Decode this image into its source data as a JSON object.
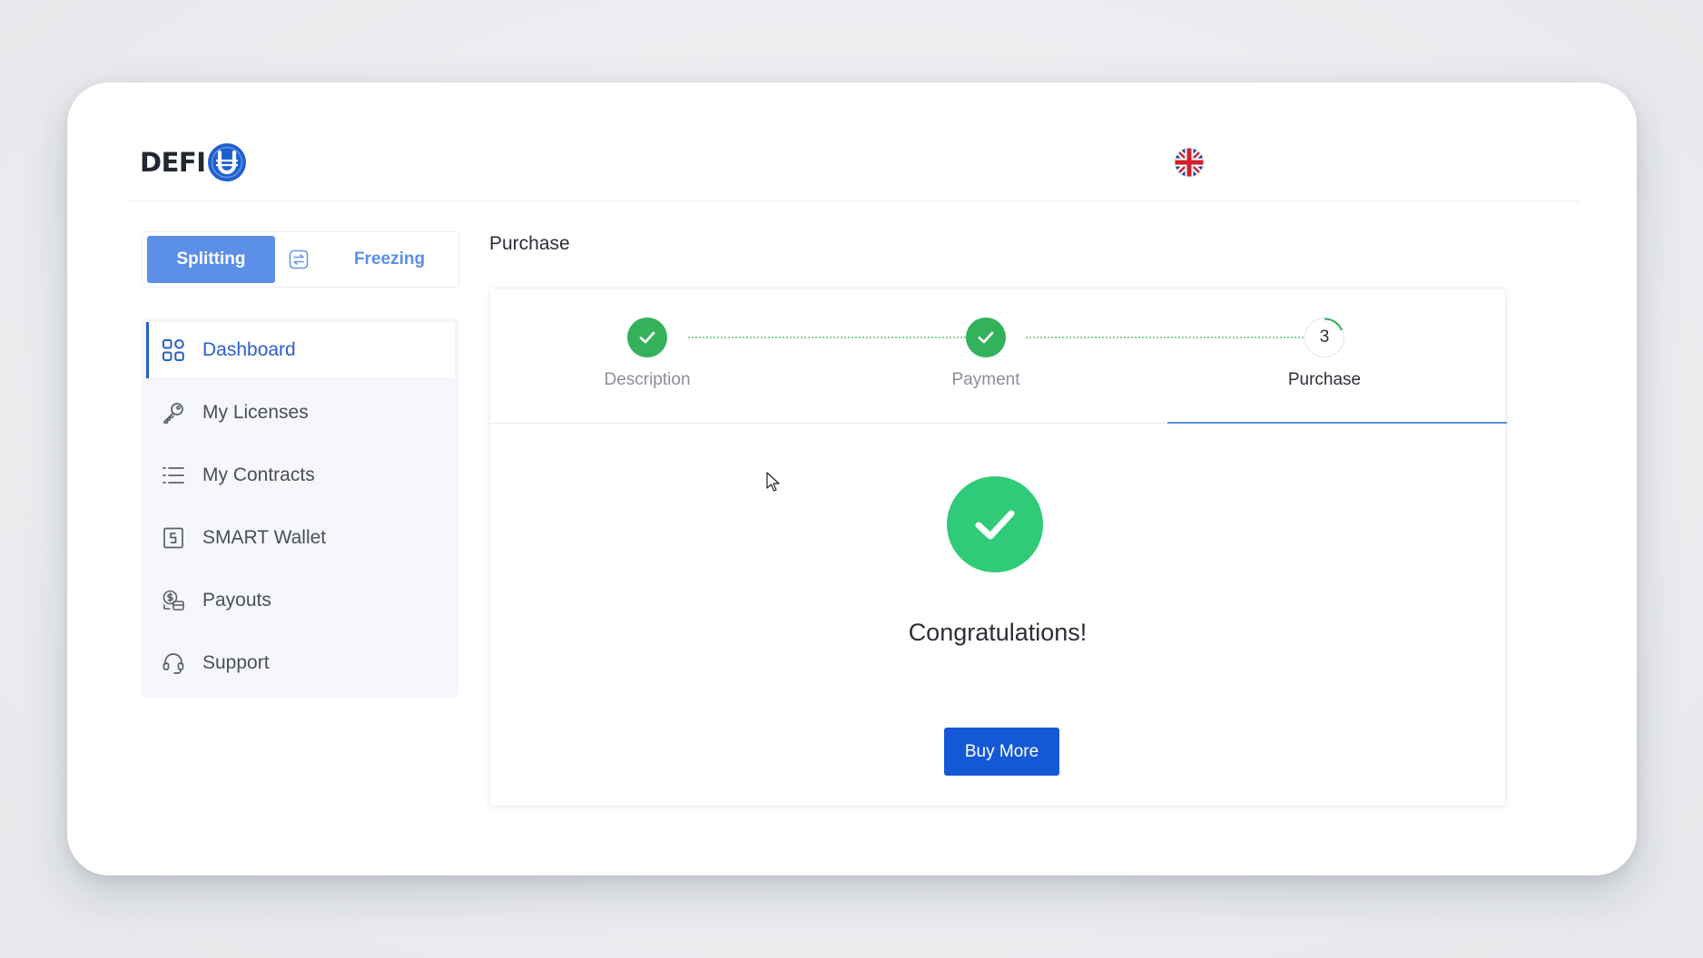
{
  "header": {
    "logo_text": "DEFI",
    "logo_badge_icon": "u-coin-icon",
    "language_icon": "uk-flag-icon"
  },
  "mode_switch": {
    "active_label": "Splitting",
    "inactive_label": "Freezing",
    "swap_icon": "swap-icon"
  },
  "sidebar": {
    "items": [
      {
        "label": "Dashboard",
        "icon": "grid-icon",
        "active": true
      },
      {
        "label": "My Licenses",
        "icon": "key-icon",
        "active": false
      },
      {
        "label": "My Contracts",
        "icon": "list-icon",
        "active": false
      },
      {
        "label": "SMART Wallet",
        "icon": "wallet-icon",
        "active": false
      },
      {
        "label": "Payouts",
        "icon": "payout-icon",
        "active": false
      },
      {
        "label": "Support",
        "icon": "headset-icon",
        "active": false
      }
    ]
  },
  "main": {
    "title": "Purchase",
    "steps": [
      {
        "label": "Description",
        "status": "done"
      },
      {
        "label": "Payment",
        "status": "done"
      },
      {
        "label": "Purchase",
        "number": "3",
        "status": "current"
      }
    ],
    "success_icon": "check-circle-icon",
    "message": "Congratulations!",
    "buy_more_label": "Buy More"
  },
  "colors": {
    "accent": "#5b8fe8",
    "primary_button": "#1558d6",
    "success": "#2fcb78",
    "step_done": "#34b15b",
    "active_nav": "#2a5fc9"
  }
}
